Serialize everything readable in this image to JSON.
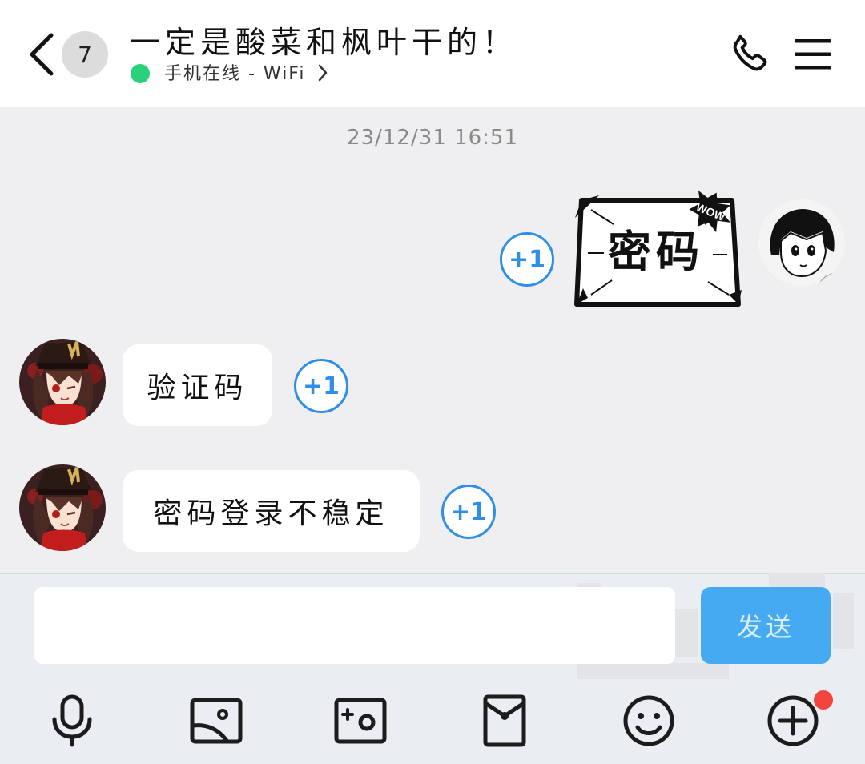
{
  "header": {
    "unread_count": "7",
    "title": "一定是酸菜和枫叶干的！",
    "status": "手机在线 - WiFi"
  },
  "colors": {
    "online": "#2ad17a",
    "accent": "#2f8fe8",
    "send": "#45aaf2",
    "badge": "#f2453d"
  },
  "messages": {
    "timestamp": "23/12/31 16:51",
    "sticker_text": "密码",
    "sticker_burst": "WOW",
    "plus_one": "+1",
    "bubble_1": "验证码",
    "bubble_2": "密码登录不稳定"
  },
  "composer": {
    "input_value": "",
    "send_label": "发送"
  },
  "toolbar": [
    "microphone-icon",
    "image-icon",
    "camera-icon",
    "red-packet-icon",
    "emoji-icon",
    "plus-icon"
  ]
}
